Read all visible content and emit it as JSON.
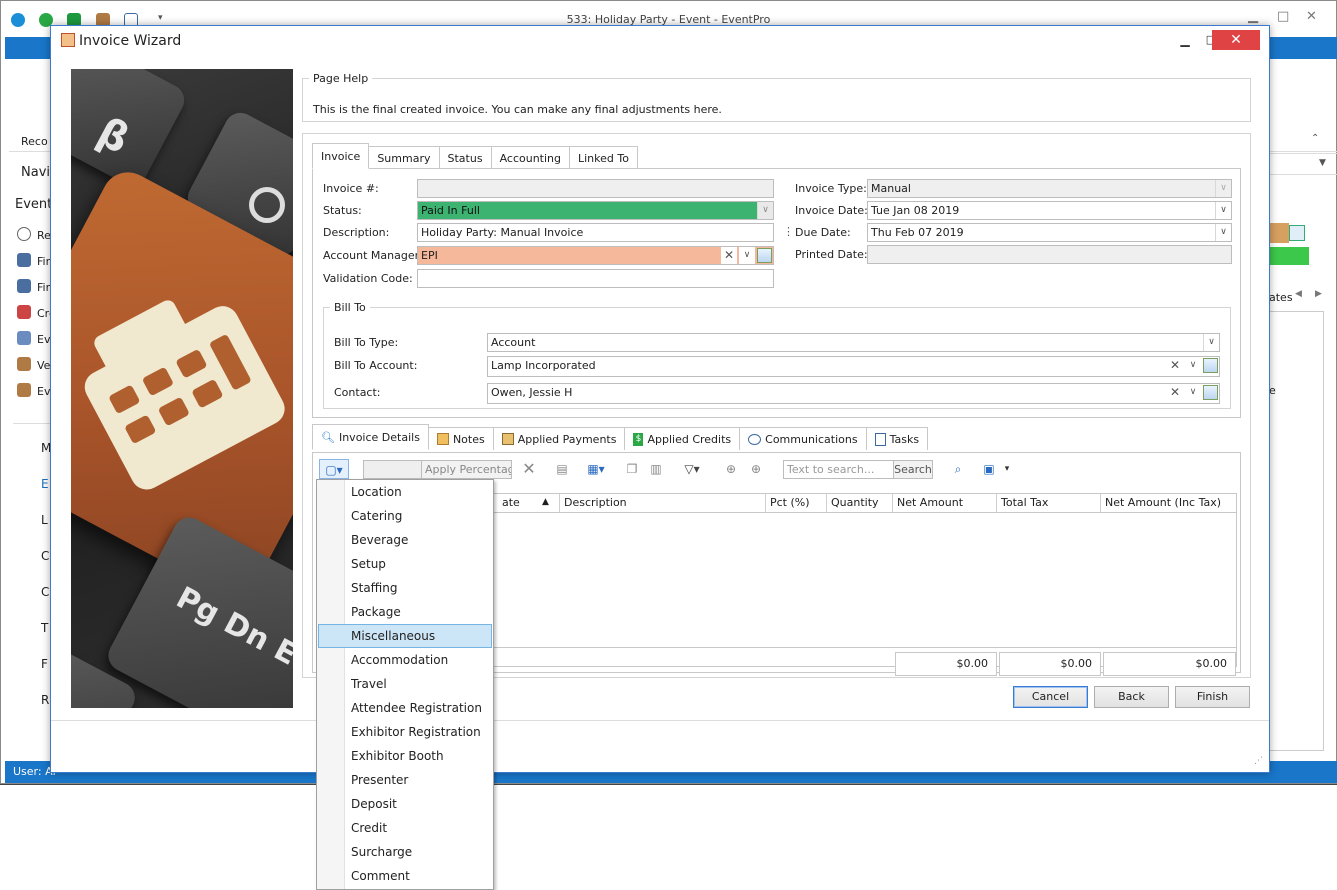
{
  "bg_app": {
    "title": "533: Holiday Party - Event - EventPro",
    "ribbon_label": "Reco",
    "nav_title": "Navig",
    "event_label": "Event",
    "nav_items": [
      "Re",
      "Fin",
      "Fin",
      "Cre",
      "Ev",
      "Ve",
      "Ev"
    ],
    "nav_items2": [
      "M",
      "E",
      "L",
      "C",
      "C",
      "T",
      "F",
      "R"
    ],
    "right_label": "ates",
    "right_label2": "e",
    "status": "User: Al"
  },
  "dialog": {
    "title": "Invoice Wizard",
    "minimize": "▁",
    "maximize": "□",
    "close": "✕"
  },
  "image_text": {
    "key1": "β",
    "key3": "Pg Dn E"
  },
  "page_help": {
    "legend": "Page Help",
    "text": "This is the final created invoice.  You can make any final adjustments here."
  },
  "top_tabs": [
    "Invoice",
    "Summary",
    "Status",
    "Accounting",
    "Linked To"
  ],
  "invoice": {
    "invoice_no_label": "Invoice #:",
    "invoice_no": "",
    "status_label": "Status:",
    "status": "Paid In Full",
    "description_label": "Description:",
    "description": "Holiday Party: Manual Invoice",
    "account_manager_label": "Account Manager:",
    "account_manager": "EPI",
    "validation_code_label": "Validation Code:",
    "validation_code": "",
    "invoice_type_label": "Invoice Type:",
    "invoice_type": "Manual",
    "invoice_date_label": "Invoice Date:",
    "invoice_date": "Tue Jan 08 2019",
    "due_date_label": "Due Date:",
    "due_date": "Thu Feb 07 2019",
    "printed_date_label": "Printed Date:",
    "printed_date": ""
  },
  "bill_to": {
    "legend": "Bill To",
    "type_label": "Bill To Type:",
    "type": "Account",
    "account_label": "Bill To Account:",
    "account": "Lamp Incorporated",
    "contact_label": "Contact:",
    "contact": "Owen, Jessie H"
  },
  "detail_tabs": [
    "Invoice Details",
    "Notes",
    "Applied Payments",
    "Applied Credits",
    "Communications",
    "Tasks"
  ],
  "toolbar": {
    "apply_percentage": "Apply Percentage",
    "search_placeholder": "Text to search...",
    "search_button": "Search"
  },
  "grid": {
    "columns": [
      "ate",
      "Description",
      "Pct (%)",
      "Quantity",
      "Net Amount",
      "Total Tax",
      "Net Amount (Inc Tax)"
    ],
    "totals": [
      "$0.00",
      "$0.00",
      "$0.00"
    ]
  },
  "buttons": {
    "cancel": "Cancel",
    "back": "Back",
    "finish": "Finish"
  },
  "add_menu": {
    "items": [
      "Location",
      "Catering",
      "Beverage",
      "Setup",
      "Staffing",
      "Package",
      "Miscellaneous",
      "Accommodation",
      "Travel",
      "Attendee Registration",
      "Exhibitor Registration",
      "Exhibitor Booth",
      "Presenter",
      "Deposit",
      "Credit",
      "Surcharge",
      "Comment"
    ],
    "selected": "Miscellaneous"
  },
  "colors": {
    "status_green": "#3cb371",
    "account_manager_salmon": "#f6b89a",
    "ribbon_blue": "#1976c9",
    "close_red": "#e04343",
    "menu_highlight": "#cde6f7"
  }
}
